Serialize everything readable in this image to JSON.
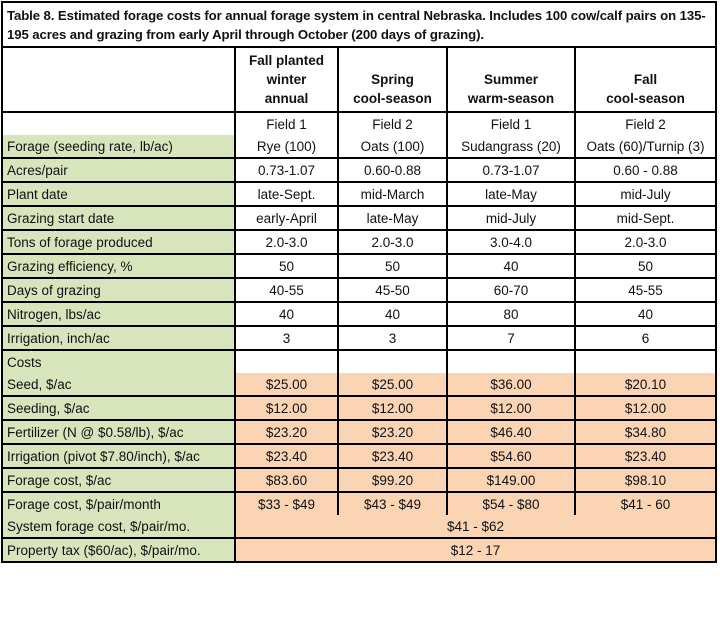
{
  "caption": "Table 8. Estimated forage costs for annual forage system in central Nebraska. Includes 100 cow/calf pairs on 135-195 acres and grazing from early April through October (200 days of grazing).",
  "colors": {
    "label_bg": "#d7e4bc",
    "cost_bg": "#fbd4b4",
    "border": "#000000"
  },
  "columns": [
    {
      "line1": "Fall planted",
      "line2": "winter",
      "line3": "annual",
      "field": "Field 1"
    },
    {
      "line1": "",
      "line2": "Spring",
      "line3": "cool-season",
      "field": "Field 2"
    },
    {
      "line1": "",
      "line2": "Summer",
      "line3": "warm-season",
      "field": "Field 1"
    },
    {
      "line1": "",
      "line2": "Fall",
      "line3": "cool-season",
      "field": "Field 2"
    }
  ],
  "rows": [
    {
      "label": "Forage (seeding rate, lb/ac)",
      "values": [
        "Rye (100)",
        "Oats (100)",
        "Sudangrass (20)",
        "Oats (60)/Turnip (3)"
      ]
    },
    {
      "label": "Acres/pair",
      "values": [
        "0.73-1.07",
        "0.60-0.88",
        "0.73-1.07",
        "0.60 - 0.88"
      ]
    },
    {
      "label": "Plant date",
      "values": [
        "late-Sept.",
        "mid-March",
        "late-May",
        "mid-July"
      ]
    },
    {
      "label": "Grazing start date",
      "values": [
        "early-April",
        "late-May",
        "mid-July",
        "mid-Sept."
      ]
    },
    {
      "label": "Tons of forage produced",
      "values": [
        "2.0-3.0",
        "2.0-3.0",
        "3.0-4.0",
        "2.0-3.0"
      ]
    },
    {
      "label": "Grazing efficiency, %",
      "values": [
        "50",
        "50",
        "40",
        "50"
      ]
    },
    {
      "label": "Days of grazing",
      "values": [
        "40-55",
        "45-50",
        "60-70",
        "45-55"
      ]
    },
    {
      "label": "Nitrogen, lbs/ac",
      "values": [
        "40",
        "40",
        "80",
        "40"
      ]
    },
    {
      "label": "Irrigation, inch/ac",
      "values": [
        "3",
        "3",
        "7",
        "6"
      ]
    },
    {
      "label": "Costs",
      "values": [
        "",
        "",
        "",
        ""
      ]
    }
  ],
  "cost_rows": [
    {
      "label": "Seed, $/ac",
      "values": [
        "$25.00",
        "$25.00",
        "$36.00",
        "$20.10"
      ]
    },
    {
      "label": "Seeding, $/ac",
      "values": [
        "$12.00",
        "$12.00",
        "$12.00",
        "$12.00"
      ]
    },
    {
      "label": "Fertilizer (N @ $0.58/lb), $/ac",
      "values": [
        "$23.20",
        "$23.20",
        "$46.40",
        "$34.80"
      ]
    },
    {
      "label": "Irrigation (pivot $7.80/inch), $/ac",
      "values": [
        "$23.40",
        "$23.40",
        "$54.60",
        "$23.40"
      ]
    },
    {
      "label": "Forage cost, $/ac",
      "values": [
        "$83.60",
        "$99.20",
        "$149.00",
        "$98.10"
      ]
    },
    {
      "label": "Forage cost, $/pair/month",
      "values": [
        "$33 - $49",
        "$43 - $49",
        "$54 - $80",
        "$41 - 60"
      ]
    }
  ],
  "summary_rows": [
    {
      "label": "System forage cost, $/pair/mo.",
      "value": "$41 - $62"
    },
    {
      "label": "Property tax ($60/ac), $/pair/mo.",
      "value": "$12 - 17"
    }
  ]
}
